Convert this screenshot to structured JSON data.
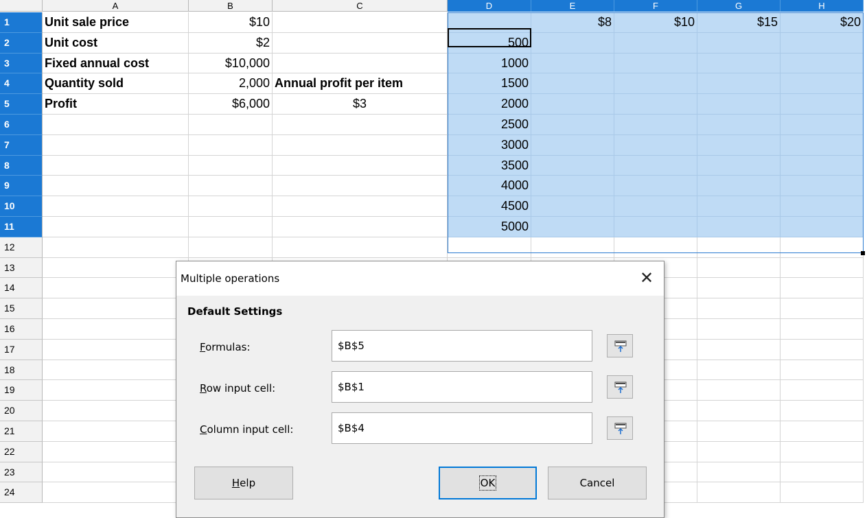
{
  "sheet": {
    "columns": [
      "A",
      "B",
      "C",
      "D",
      "E",
      "F",
      "G",
      "H"
    ],
    "rows": [
      "1",
      "2",
      "3",
      "4",
      "5",
      "6",
      "7",
      "8",
      "9",
      "10",
      "11",
      "12",
      "13",
      "14",
      "15",
      "16",
      "17",
      "18",
      "19",
      "20",
      "21",
      "22",
      "23",
      "24"
    ],
    "cells": {
      "A1": "Unit sale price",
      "B1": "$10",
      "E1": "$8",
      "F1": "$10",
      "G1": "$15",
      "H1": "$20",
      "A2": "Unit cost",
      "B2": "$2",
      "D2": "500",
      "A3": "Fixed annual cost",
      "B3": "$10,000",
      "D3": "1000",
      "A4": "Quantity sold",
      "B4": "2,000",
      "C4": "Annual profit per item",
      "D4": "1500",
      "A5": "Profit",
      "B5": "$6,000",
      "C5": "$3",
      "D5": "2000",
      "D6": "2500",
      "D7": "3000",
      "D8": "3500",
      "D9": "4000",
      "D10": "4500",
      "D11": "5000"
    },
    "selection_color": "#bfdbf5",
    "header_selected_color": "#1b79d4"
  },
  "dialog": {
    "title": "Multiple operations",
    "close_glyph": "✕",
    "section_title": "Default Settings",
    "fields": [
      {
        "label_mnemonic": "F",
        "label_rest": "ormulas:",
        "value": "$B$5"
      },
      {
        "label_mnemonic": "R",
        "label_rest": "ow input cell:",
        "value": "$B$1"
      },
      {
        "label_mnemonic": "C",
        "label_rest": "olumn input cell:",
        "value": "$B$4"
      }
    ],
    "buttons": {
      "help_mnemonic": "H",
      "help_rest": "elp",
      "ok": "OK",
      "cancel": "Cancel"
    },
    "accent_color": "#0078d7"
  }
}
